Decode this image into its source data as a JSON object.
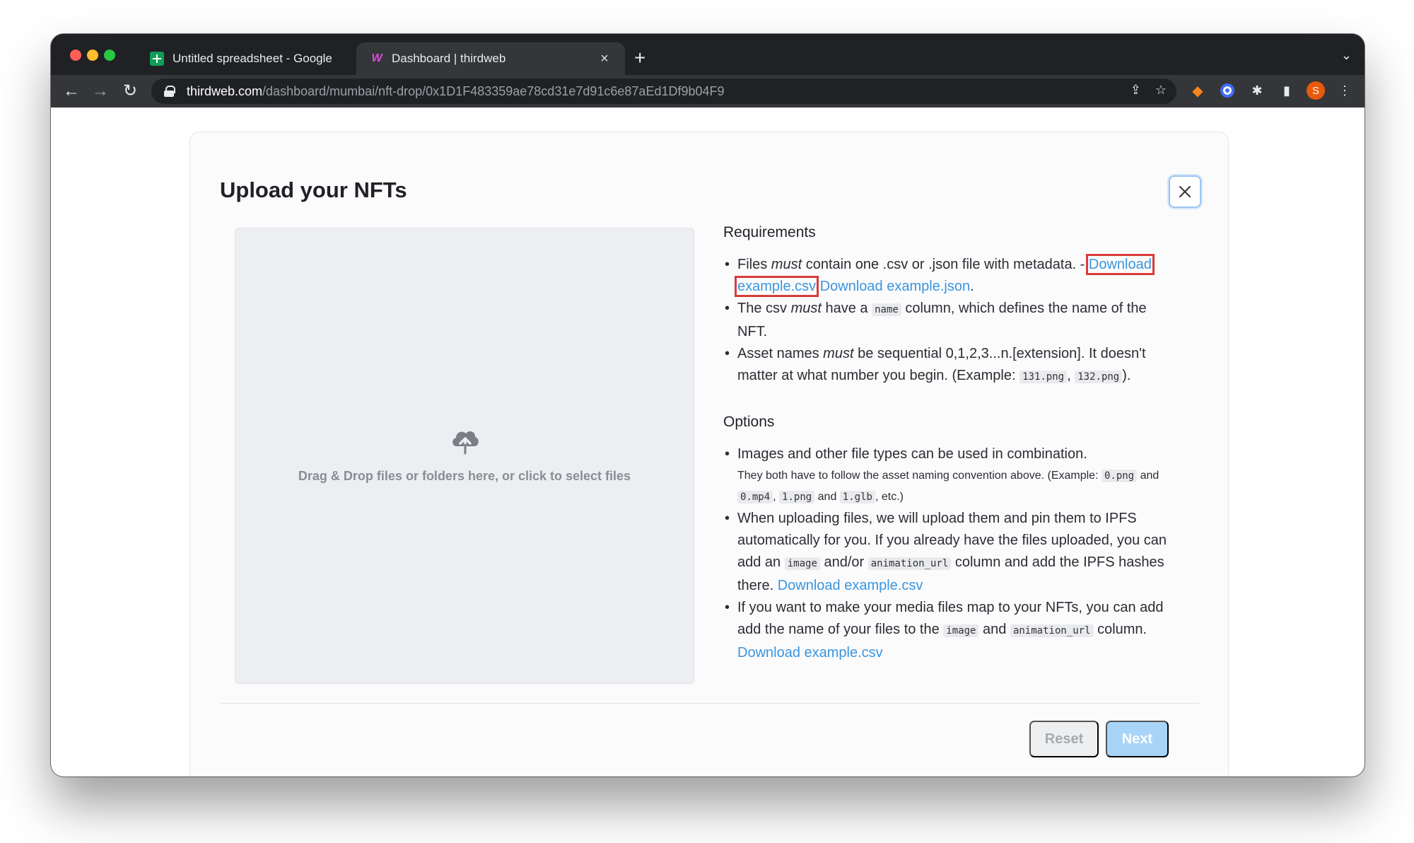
{
  "browser": {
    "tabs": [
      {
        "title": "Untitled spreadsheet - Google",
        "favicon": "sheets-icon",
        "active": false
      },
      {
        "title": "Dashboard | thirdweb",
        "favicon": "thirdweb-icon",
        "active": true
      }
    ],
    "new_tab_symbol": "+",
    "url_host": "thirdweb.com",
    "url_path": "/dashboard/mumbai/nft-drop/0x1D1F483359ae78cd31e7d91c6e87aEd1Df9b04F9",
    "avatar_letter": "S",
    "colors": {
      "chrome_bg": "#202124",
      "toolbar_bg": "#35363a",
      "avatar": "#e8590c"
    }
  },
  "modal": {
    "title": "Upload your NFTs",
    "dropzone_text": "Drag & Drop files or folders here, or click to select files",
    "requirements": {
      "heading": "Requirements",
      "item1": {
        "pre": "Files ",
        "em": "must",
        "post": " contain one .csv or .json file with metadata. - ",
        "link_csv": "Download example.csv",
        "link_json": "Download example.json",
        "end": "."
      },
      "item2": {
        "pre": "The csv ",
        "em": "must",
        "mid": " have a ",
        "code": "name",
        "post": " column, which defines the name of the NFT."
      },
      "item3": {
        "pre": "Asset names ",
        "em": "must",
        "post": " be sequential 0,1,2,3...n.[extension]. It doesn't matter at what number you begin. (Example: ",
        "code1": "131.png",
        "sep": ", ",
        "code2": "132.png",
        "end": ")."
      }
    },
    "options": {
      "heading": "Options",
      "item1": {
        "text": "Images and other file types can be used in combination.",
        "note_pre": "They both have to follow the asset naming convention above. (Example: ",
        "code1": "0.png",
        "and1": " and ",
        "code2": "0.mp4",
        "sep": ", ",
        "code3": "1.png",
        "and2": " and ",
        "code4": "1.glb",
        "note_end": ", etc.)"
      },
      "item2": {
        "pre": "When uploading files, we will upload them and pin them to IPFS automatically for you. If you already have the files uploaded, you can add an ",
        "code1": "image",
        "mid": " and/or ",
        "code2": "animation_url",
        "post": " column and add the IPFS hashes there. ",
        "link": "Download example.csv"
      },
      "item3": {
        "pre": "If you want to make your media files map to your NFTs, you can add add the name of your files to the ",
        "code1": "image",
        "mid": " and ",
        "code2": "animation_url",
        "post": " column. ",
        "link": "Download example.csv"
      }
    },
    "buttons": {
      "reset": "Reset",
      "next": "Next"
    },
    "colors": {
      "link": "#3b95df",
      "highlight": "#d93b3b",
      "next_bg": "#a8d4f8"
    }
  }
}
